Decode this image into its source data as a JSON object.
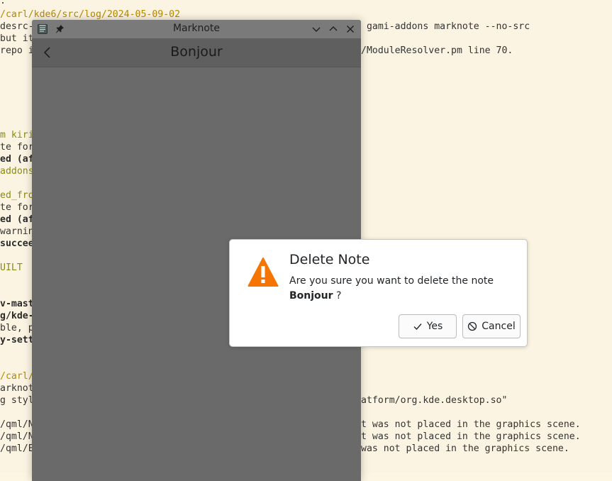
{
  "terminal": {
    "lines_left": [
      {
        "text": ".",
        "style": "dark"
      },
      {
        "text": "/carl/kde6/src/log/2024-05-09-02",
        "style": "gold"
      },
      {
        "text": "desrc-",
        "style": "dark"
      },
      {
        "text": "but it",
        "style": "dark"
      },
      {
        "text": "repo i",
        "style": "dark"
      },
      {
        "text": "m kiri",
        "style": "olive"
      },
      {
        "text": "te for",
        "style": "dark"
      },
      {
        "text": "ed (af",
        "style": "bold"
      },
      {
        "text": "addons",
        "style": "olive"
      },
      {
        "text": "ed_fro",
        "style": "olive"
      },
      {
        "text": "te for",
        "style": "dark"
      },
      {
        "text": "ed (af",
        "style": "bold"
      },
      {
        "text": "warnin",
        "style": "dark"
      },
      {
        "text": "succee",
        "style": "bold"
      },
      {
        "text": "UILT",
        "style": "olive"
      },
      {
        "text": "v-mast",
        "style": "bold"
      },
      {
        "text": "g/kde-",
        "style": "bold"
      },
      {
        "text": "ble, p",
        "style": "dark"
      },
      {
        "text": "y-sett",
        "style": "bold"
      },
      {
        "text": "/carl/",
        "style": "gold"
      },
      {
        "text": "arknot",
        "style": "dark"
      },
      {
        "text": "g styl",
        "style": "dark"
      },
      {
        "text": "/qml/N",
        "style": "dark"
      },
      {
        "text": "/qml/N",
        "style": "dark"
      },
      {
        "text": "/qml/E",
        "style": "dark"
      }
    ],
    "lines_right": [
      {
        "text": " gami-addons marknote --no-src",
        "style": "dark"
      },
      {
        "text": "/ModuleResolver.pm line 70.",
        "style": "dark"
      },
      {
        "text": "atform/org.kde.desktop.so\"",
        "style": "dark"
      },
      {
        "text": "t was not placed in the graphics scene.",
        "style": "dark"
      },
      {
        "text": "t was not placed in the graphics scene.",
        "style": "dark"
      },
      {
        "text": "was not placed in the graphics scene.",
        "style": "dark"
      }
    ]
  },
  "window": {
    "title": "Marknote",
    "app_icon": "marknote-app-icon",
    "pin_icon": "pin-icon",
    "controls": [
      "minimize-chevron-down-icon",
      "maximize-chevron-up-icon",
      "close-icon"
    ]
  },
  "header": {
    "back_icon": "chevron-left-icon",
    "note_title": "Bonjour"
  },
  "dialog": {
    "icon": "warning-icon",
    "title": "Delete Note",
    "message_prefix": "Are you sure you want to delete the note",
    "note_name": "Bonjour",
    "message_suffix": " ?",
    "yes_label": "Yes",
    "cancel_label": "Cancel",
    "accent_warning": "#f67400"
  }
}
